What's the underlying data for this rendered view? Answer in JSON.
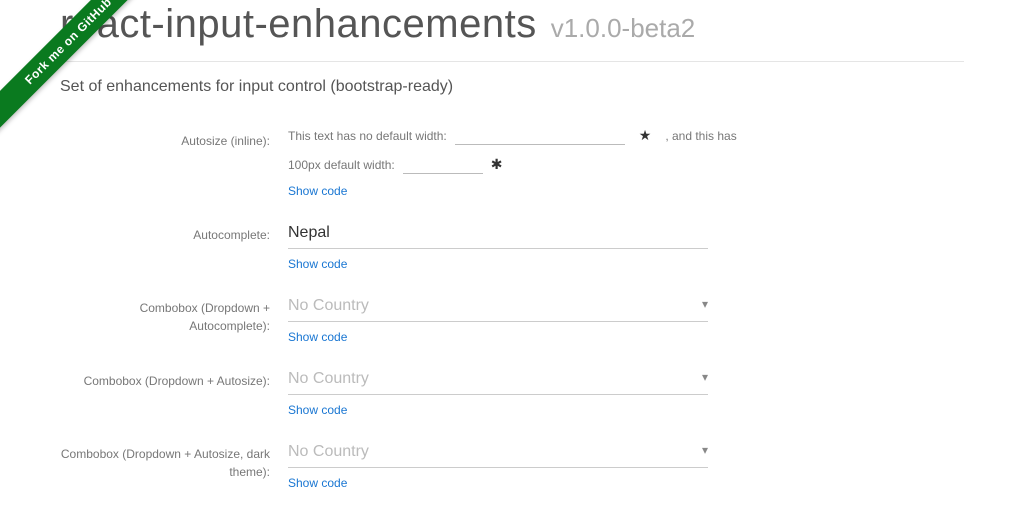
{
  "ribbon": {
    "label": "Fork me on GitHub"
  },
  "header": {
    "title": "react-input-enhancements",
    "version": "v1.0.0-beta2",
    "subtitle": "Set of enhancements for input control (bootstrap-ready)"
  },
  "show_code_label": "Show code",
  "rows": {
    "autosize_inline": {
      "label": "Autosize (inline):",
      "line1_prefix": "This text has no default width:",
      "line1_suffix": ", and this has",
      "line2_label": "100px default width:"
    },
    "autocomplete": {
      "label": "Autocomplete:",
      "value": "Nepal"
    },
    "combobox_ac": {
      "label": "Combobox (Dropdown + Autocomplete):",
      "placeholder": "No Country"
    },
    "combobox_autosize": {
      "label": "Combobox (Dropdown + Autosize):",
      "placeholder": "No Country"
    },
    "combobox_dark": {
      "label": "Combobox (Dropdown + Autosize, dark theme):",
      "placeholder": "No Country"
    }
  },
  "icons": {
    "star": "★",
    "gear": "✱",
    "caret": "▾"
  }
}
